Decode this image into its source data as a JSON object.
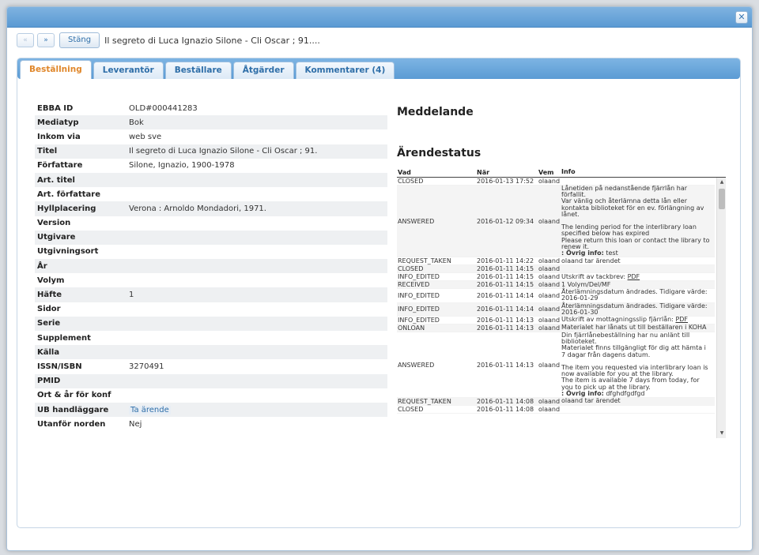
{
  "dialog": {
    "close_icon": "close-icon"
  },
  "nav": {
    "prev_label": "«",
    "next_label": "»",
    "close_label": "Stäng",
    "title": "Il segreto di Luca Ignazio Silone - Cli Oscar ; 91...."
  },
  "tabs": [
    {
      "label": "Beställning"
    },
    {
      "label": "Leverantör"
    },
    {
      "label": "Beställare"
    },
    {
      "label": "Åtgärder"
    },
    {
      "label": "Kommentarer (4)"
    }
  ],
  "fields": [
    {
      "label": "EBBA ID",
      "value": "OLD#000441283"
    },
    {
      "label": "Mediatyp",
      "value": "Bok"
    },
    {
      "label": "Inkom via",
      "value": "web sve"
    },
    {
      "label": "Titel",
      "value": "Il segreto di Luca Ignazio Silone - Cli Oscar ; 91."
    },
    {
      "label": "Författare",
      "value": "Silone, Ignazio, 1900-1978"
    },
    {
      "label": "Art. titel",
      "value": ""
    },
    {
      "label": "Art. författare",
      "value": ""
    },
    {
      "label": "Hyllplacering",
      "value": "Verona : Arnoldo Mondadori, 1971."
    },
    {
      "label": "Version",
      "value": ""
    },
    {
      "label": "Utgivare",
      "value": ""
    },
    {
      "label": "Utgivningsort",
      "value": ""
    },
    {
      "label": "År",
      "value": ""
    },
    {
      "label": "Volym",
      "value": ""
    },
    {
      "label": "Häfte",
      "value": "1"
    },
    {
      "label": "Sidor",
      "value": ""
    },
    {
      "label": "Serie",
      "value": ""
    },
    {
      "label": "Supplement",
      "value": ""
    },
    {
      "label": "Källa",
      "value": ""
    },
    {
      "label": "ISSN/ISBN",
      "value": "3270491"
    },
    {
      "label": "PMID",
      "value": ""
    },
    {
      "label": "Ort & år för konf",
      "value": ""
    },
    {
      "label": "UB handläggare",
      "value": "Ta ärende"
    },
    {
      "label": "Utanför norden",
      "value": "Nej"
    }
  ],
  "message_heading": "Meddelande",
  "status_heading": "Ärendestatus",
  "status_columns": [
    "Vad",
    "När",
    "Vem",
    "Info"
  ],
  "status_rows": [
    {
      "vad": "CLOSED",
      "nar": "2016-01-13 17:52",
      "vem": "olaand",
      "info": ""
    },
    {
      "vad": "ANSWERED",
      "nar": "2016-01-12 09:34",
      "vem": "olaand",
      "info": "Lånetiden på nedanstående fjärrlån har\nförfallit.\nVar vänlig och återlämna detta lån eller\nkontakta biblioteket för en ev. förlängning av\nlånet.\n\nThe lending period for the interlibrary loan\nspecified below has expired\nPlease return this loan or contact the library to\nrenew it.",
      "extra_label": ": Övrig info:",
      "extra_value": " test"
    },
    {
      "vad": "REQUEST_TAKEN",
      "nar": "2016-01-11 14:22",
      "vem": "olaand",
      "info": "olaand tar ärendet"
    },
    {
      "vad": "CLOSED",
      "nar": "2016-01-11 14:15",
      "vem": "olaand",
      "info": ""
    },
    {
      "vad": "INFO_EDITED",
      "nar": "2016-01-11 14:15",
      "vem": "olaand",
      "info": "Utskrift av tackbrev: ",
      "pdf": "PDF"
    },
    {
      "vad": "RECEIVED",
      "nar": "2016-01-11 14:15",
      "vem": "olaand",
      "info": "1 Volym/Del/MF"
    },
    {
      "vad": "INFO_EDITED",
      "nar": "2016-01-11 14:14",
      "vem": "olaand",
      "info": "Återlämningsdatum ändrades. Tidigare värde:\n2016-01-29"
    },
    {
      "vad": "INFO_EDITED",
      "nar": "2016-01-11 14:14",
      "vem": "olaand",
      "info": "Återlämningsdatum ändrades. Tidigare värde:\n2016-01-30"
    },
    {
      "vad": "INFO_EDITED",
      "nar": "2016-01-11 14:13",
      "vem": "olaand",
      "info": "Utskrift av mottagningsslip fjärrlån: ",
      "pdf": "PDF"
    },
    {
      "vad": "ONLOAN",
      "nar": "2016-01-11 14:13",
      "vem": "olaand",
      "info": "Materialet har lånats ut till beställaren i KOHA"
    },
    {
      "vad": "ANSWERED",
      "nar": "2016-01-11 14:13",
      "vem": "olaand",
      "info": "Din fjärrlånebeställning har nu anlänt till\nbiblioteket.\nMaterialet finns tillgängligt för dig att hämta i\n7 dagar från dagens datum.\n\nThe item you requested via interlibrary loan is\nnow available for you at the library.\nThe item is available 7 days from today, for\nyou to pick up at the library.",
      "extra_label": ": Övrig info:",
      "extra_value": " dfghdfgdfgd"
    },
    {
      "vad": "REQUEST_TAKEN",
      "nar": "2016-01-11 14:08",
      "vem": "olaand",
      "info": "olaand tar ärendet"
    },
    {
      "vad": "CLOSED",
      "nar": "2016-01-11 14:08",
      "vem": "olaand",
      "info": ""
    }
  ]
}
